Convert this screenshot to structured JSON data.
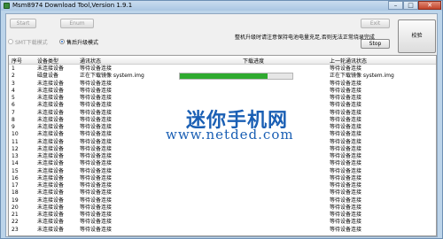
{
  "window": {
    "title": "Msm8974 Download Tool,Version 1.9.1",
    "controls": {
      "minimize": "–",
      "maximize": "□",
      "close": "✕"
    }
  },
  "toolbar": {
    "start_label": "Start",
    "enum_label": "Enum",
    "exit_label": "Exit",
    "stop_label": "Stop",
    "verify_label": "校验"
  },
  "modes": {
    "smt_label": "SMT下载模式",
    "aftersale_label": "售后升级模式"
  },
  "notice": "整机升级时请注意保持电池电量充足,否则无法正常烧录完成",
  "table": {
    "headers": {
      "index": "序号",
      "device_type": "设备类型",
      "comm_status": "通讯状态",
      "progress": "下载进度",
      "last_status": "上一轮通讯状态"
    },
    "rows": [
      {
        "index": "1",
        "device_type": "未连接设备",
        "comm_status": "等待设备连接",
        "last_status": "等待设备连接"
      },
      {
        "index": "2",
        "device_type": "磁盘设备",
        "comm_status": "正在下载镜像 system.img",
        "last_status": "正在下载镜像 system.img",
        "progress": 0.78
      },
      {
        "index": "3",
        "device_type": "未连接设备",
        "comm_status": "等待设备连接",
        "last_status": "等待设备连接"
      },
      {
        "index": "4",
        "device_type": "未连接设备",
        "comm_status": "等待设备连接",
        "last_status": "等待设备连接"
      },
      {
        "index": "5",
        "device_type": "未连接设备",
        "comm_status": "等待设备连接",
        "last_status": "等待设备连接"
      },
      {
        "index": "6",
        "device_type": "未连接设备",
        "comm_status": "等待设备连接",
        "last_status": "等待设备连接"
      },
      {
        "index": "7",
        "device_type": "未连接设备",
        "comm_status": "等待设备连接",
        "last_status": "等待设备连接"
      },
      {
        "index": "8",
        "device_type": "未连接设备",
        "comm_status": "等待设备连接",
        "last_status": "等待设备连接"
      },
      {
        "index": "9",
        "device_type": "未连接设备",
        "comm_status": "等待设备连接",
        "last_status": "等待设备连接"
      },
      {
        "index": "10",
        "device_type": "未连接设备",
        "comm_status": "等待设备连接",
        "last_status": "等待设备连接"
      },
      {
        "index": "11",
        "device_type": "未连接设备",
        "comm_status": "等待设备连接",
        "last_status": "等待设备连接"
      },
      {
        "index": "12",
        "device_type": "未连接设备",
        "comm_status": "等待设备连接",
        "last_status": "等待设备连接"
      },
      {
        "index": "13",
        "device_type": "未连接设备",
        "comm_status": "等待设备连接",
        "last_status": "等待设备连接"
      },
      {
        "index": "14",
        "device_type": "未连接设备",
        "comm_status": "等待设备连接",
        "last_status": "等待设备连接"
      },
      {
        "index": "15",
        "device_type": "未连接设备",
        "comm_status": "等待设备连接",
        "last_status": "等待设备连接"
      },
      {
        "index": "16",
        "device_type": "未连接设备",
        "comm_status": "等待设备连接",
        "last_status": "等待设备连接"
      },
      {
        "index": "17",
        "device_type": "未连接设备",
        "comm_status": "等待设备连接",
        "last_status": "等待设备连接"
      },
      {
        "index": "18",
        "device_type": "未连接设备",
        "comm_status": "等待设备连接",
        "last_status": "等待设备连接"
      },
      {
        "index": "19",
        "device_type": "未连接设备",
        "comm_status": "等待设备连接",
        "last_status": "等待设备连接"
      },
      {
        "index": "20",
        "device_type": "未连接设备",
        "comm_status": "等待设备连接",
        "last_status": "等待设备连接"
      },
      {
        "index": "21",
        "device_type": "未连接设备",
        "comm_status": "等待设备连接",
        "last_status": "等待设备连接"
      },
      {
        "index": "22",
        "device_type": "未连接设备",
        "comm_status": "等待设备连接",
        "last_status": "等待设备连接"
      },
      {
        "index": "23",
        "device_type": "未连接设备",
        "comm_status": "等待设备连接",
        "last_status": "等待设备连接"
      }
    ]
  },
  "watermark": {
    "title": "迷你手机网",
    "url": "www.netded.com",
    "color": "#1a5fb4"
  },
  "colors": {
    "titlebar": "#bcd4ea",
    "progress_fill": "#2faa2f"
  }
}
